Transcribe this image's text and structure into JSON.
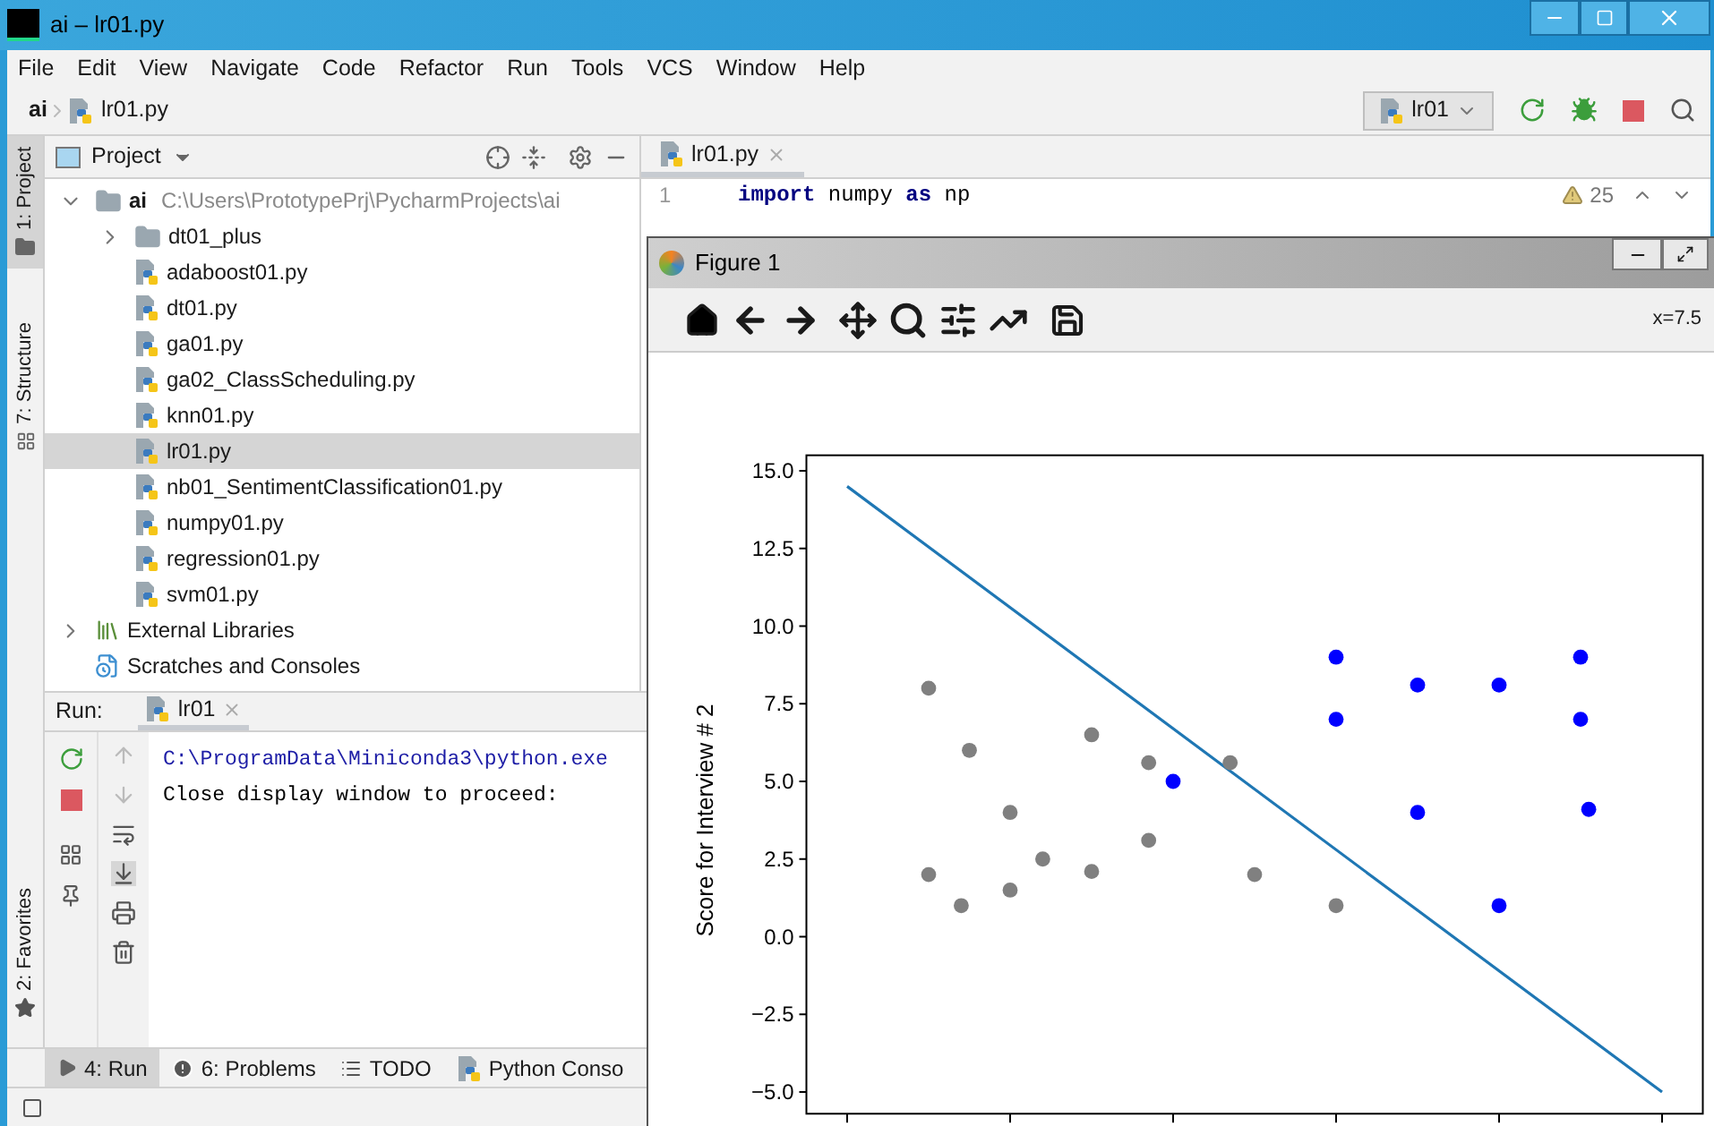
{
  "window": {
    "title": "ai – lr01.py"
  },
  "menu": [
    "File",
    "Edit",
    "View",
    "Navigate",
    "Code",
    "Refactor",
    "Run",
    "Tools",
    "VCS",
    "Window",
    "Help"
  ],
  "breadcrumb": [
    "ai",
    "lr01.py"
  ],
  "run_config": {
    "label": "lr01"
  },
  "side_stripe": [
    {
      "label": "1: Project",
      "selected": true,
      "kind": "project"
    },
    {
      "label": "7: Structure",
      "selected": false,
      "kind": "structure"
    },
    {
      "label": "2: Favorites",
      "selected": false,
      "kind": "favorites"
    }
  ],
  "project_panel": {
    "title": "Project",
    "tree": [
      {
        "name": "ai",
        "path": "C:\\Users\\PrototypePrj\\PycharmProjects\\ai",
        "kind": "folder",
        "expanded": true,
        "selected": false,
        "children": [
          {
            "name": "dt01_plus",
            "kind": "folder",
            "expanded": false,
            "selected": false
          },
          {
            "name": "adaboost01.py",
            "kind": "python",
            "selected": false
          },
          {
            "name": "dt01.py",
            "kind": "python",
            "selected": false
          },
          {
            "name": "ga01.py",
            "kind": "python",
            "selected": false
          },
          {
            "name": "ga02_ClassScheduling.py",
            "kind": "python",
            "selected": false
          },
          {
            "name": "knn01.py",
            "kind": "python",
            "selected": false
          },
          {
            "name": "lr01.py",
            "kind": "python",
            "selected": true
          },
          {
            "name": "nb01_SentimentClassification01.py",
            "kind": "python",
            "selected": false
          },
          {
            "name": "numpy01.py",
            "kind": "python",
            "selected": false
          },
          {
            "name": "regression01.py",
            "kind": "python",
            "selected": false
          },
          {
            "name": "svm01.py",
            "kind": "python",
            "selected": false
          }
        ]
      },
      {
        "name": "External Libraries",
        "kind": "library",
        "expanded": false,
        "selected": false
      },
      {
        "name": "Scratches and Consoles",
        "kind": "scratches",
        "selected": false
      }
    ]
  },
  "editor": {
    "tab": "lr01.py",
    "warnings": "25",
    "lines": [
      {
        "number": "1",
        "code": [
          {
            "text": "import",
            "kind": "keyword"
          },
          {
            "text": " numpy ",
            "kind": "plain"
          },
          {
            "text": "as",
            "kind": "keyword"
          },
          {
            "text": " np",
            "kind": "plain"
          }
        ]
      }
    ]
  },
  "run_panel": {
    "label": "Run:",
    "tab": "lr01",
    "output": [
      "C:\\ProgramData\\Miniconda3\\python.exe",
      "Close display window to proceed:"
    ]
  },
  "bottom_tabs": [
    {
      "label": "4: Run",
      "selected": true,
      "kind": "run"
    },
    {
      "label": "6: Problems",
      "selected": false,
      "kind": "problems"
    },
    {
      "label": "TODO",
      "selected": false,
      "kind": "todo"
    },
    {
      "label": "Python Conso",
      "selected": false,
      "kind": "python"
    }
  ],
  "figure": {
    "title": "Figure 1",
    "coords": "x=7.5",
    "plot": {
      "ylabel": "Score for Interview # 2",
      "ytick_labels": [
        "15.0",
        "12.5",
        "10.0",
        "7.5",
        "5.0",
        "2.5",
        "0.0",
        "−2.5",
        "−5.0"
      ]
    }
  }
}
